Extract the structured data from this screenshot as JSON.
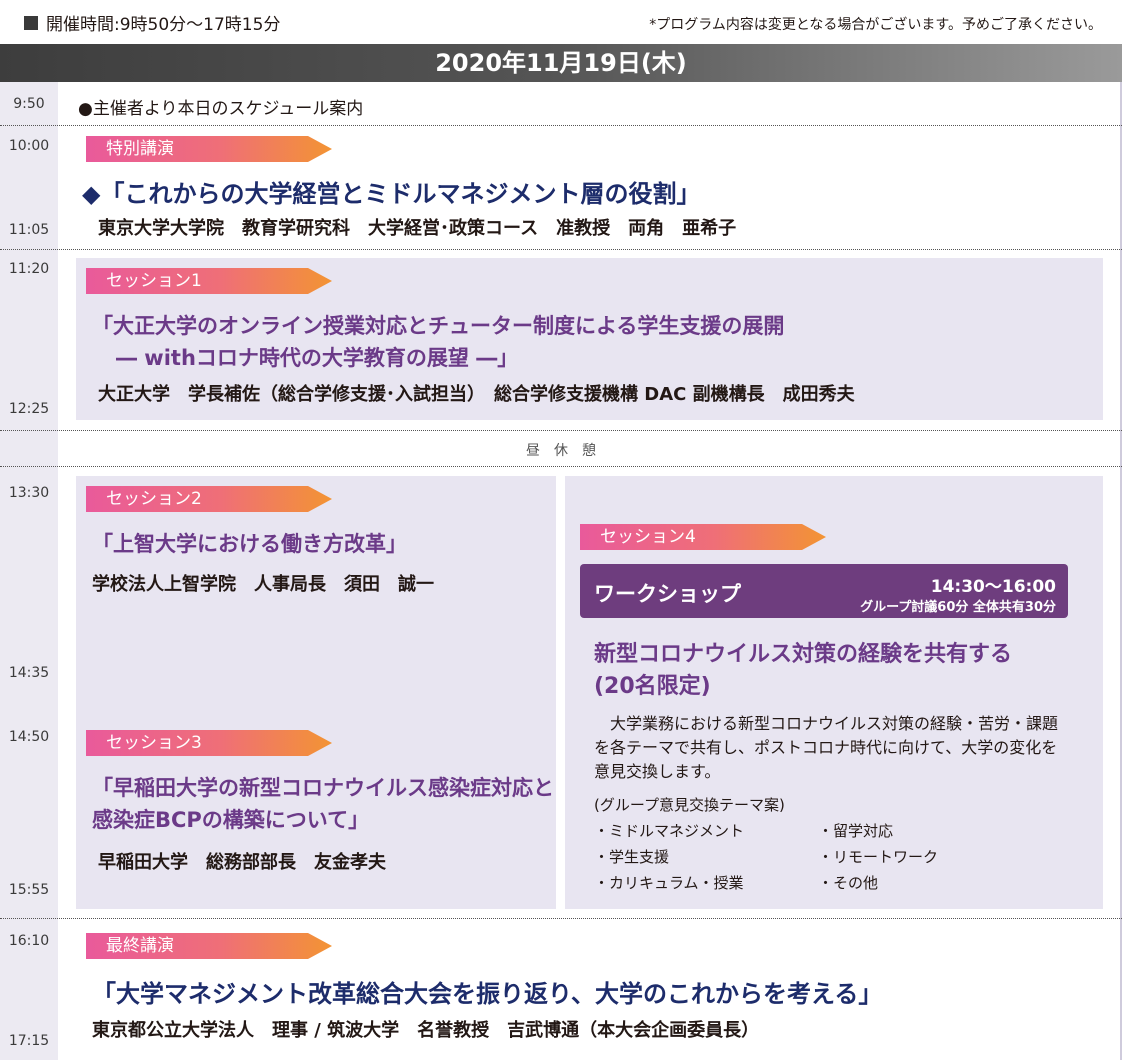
{
  "header": {
    "hours_label": "開催時間:9時50分～17時15分",
    "notice": "*プログラム内容は変更となる場合がございます。予めご了承ください。"
  },
  "date_bar": "2020年11月19日(木)",
  "times": {
    "t0950": "9:50",
    "t1000": "10:00",
    "t1105": "11:05",
    "t1120": "11:20",
    "t1225": "12:25",
    "t1330": "13:30",
    "t1435": "14:35",
    "t1450": "14:50",
    "t1555": "15:55",
    "t1610": "16:10",
    "t1715": "17:15"
  },
  "intro": "●主催者より本日のスケジュール案内",
  "special": {
    "tag": "特別講演",
    "title": "◆「これからの大学経営とミドルマネジメント層の役割」",
    "speaker": "東京大学大学院　教育学研究科　大学経営･政策コース　准教授　両角　亜希子"
  },
  "session1": {
    "tag": "セッション1",
    "title_line1": "「大正大学のオンライン授業対応とチューター制度による学生支援の展開",
    "title_line2": "― withコロナ時代の大学教育の展望 ―」",
    "speaker": "大正大学　学長補佐（総合学修支援･入試担当）　総合学修支援機構 DAC 副機構長　成田秀夫"
  },
  "lunch": "昼　休　憩",
  "session2": {
    "tag": "セッション2",
    "title": "「上智大学における働き方改革」",
    "speaker": "学校法人上智学院　人事局長　須田　誠一"
  },
  "session3": {
    "tag": "セッション3",
    "title_line1": "「早稲田大学の新型コロナウイルス感染症対応と",
    "title_line2": "感染症BCPの構築について」",
    "speaker": "早稲田大学　総務部部長　友金孝夫"
  },
  "session4": {
    "tag": "セッション4",
    "workshop_label": "ワークショップ",
    "workshop_time": "14:30～16:00",
    "workshop_sub": "グループ討議60分 全体共有30分",
    "title_line1": "新型コロナウイルス対策の経験を共有する",
    "title_line2": "(20名限定)",
    "description": "大学業務における新型コロナウイルス対策の経験・苦労・課題を各テーマで共有し、ポストコロナ時代に向けて、大学の変化を意見交換します。",
    "topics_heading": "(グループ意見交換テーマ案)",
    "topics_left": [
      "・ミドルマネジメント",
      "・学生支援",
      "・カリキュラム・授業"
    ],
    "topics_right": [
      "・留学対応",
      "・リモートワーク",
      "・その他"
    ]
  },
  "final": {
    "tag": "最終講演",
    "title": "「大学マネジメント改革総合大会を振り返り、大学のこれからを考える」",
    "speaker": "東京都公立大学法人　理事 / 筑波大学　名誉教授　吉武博通（本大会企画委員長）"
  },
  "colors": {
    "navy": "#1d2c6b",
    "purple": "#6b3a88",
    "panel": "#e8e5f1",
    "workshop": "#6e3d7e",
    "tag_start": "#e95a9b",
    "tag_end": "#f39433"
  }
}
